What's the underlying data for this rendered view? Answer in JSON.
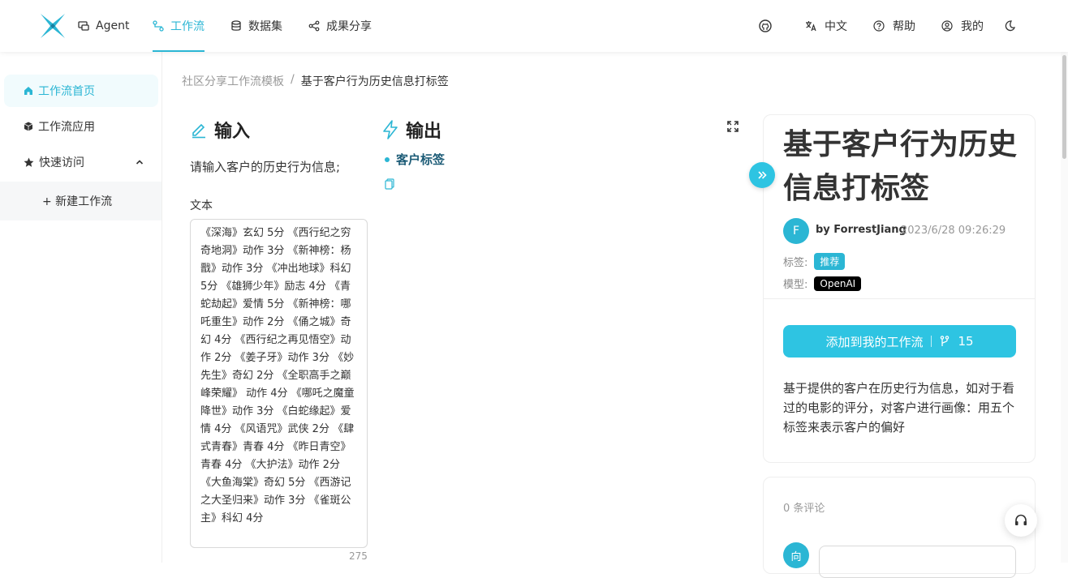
{
  "nav": {
    "items": [
      {
        "label": "Agent",
        "icon": "chat-icon"
      },
      {
        "label": "工作流",
        "icon": "workflow-icon",
        "active": true
      },
      {
        "label": "数据集",
        "icon": "database-icon"
      },
      {
        "label": "成果分享",
        "icon": "share-icon"
      }
    ],
    "lang": "中文",
    "help": "帮助",
    "mine": "我的"
  },
  "sidebar": {
    "items": [
      {
        "label": "工作流首页",
        "icon": "home-icon",
        "active": true
      },
      {
        "label": "工作流应用",
        "icon": "cube-icon"
      },
      {
        "label": "快速访问",
        "icon": "star-icon"
      }
    ],
    "sub_item": "+ 新建工作流"
  },
  "breadcrumb": {
    "parent": "社区分享工作流模板",
    "sep": "/",
    "current": "基于客户行为历史信息打标签"
  },
  "input": {
    "title": "输入",
    "prompt": "请输入客户的历史行为信息;",
    "field_label": "文本",
    "text": "《深海》玄幻  5分 《西行纪之穷奇地洞》动作 3分 《新神榜：杨戬》动作 3分 《冲出地球》科幻 5分  《雄狮少年》励志 4分 《青蛇劫起》爱情 5分 《新神榜：哪吒重生》动作 2分 《俑之城》奇幻 4分 《西行纪之再见悟空》动作 2分 《姜子牙》动作 3分 《妙先生》奇幻 2分 《全职高手之巅峰荣耀》 动作 4分 《哪吒之魔童降世》动作 3分 《白蛇缘起》爱情 4分 《风语咒》武侠 2分 《肆式青春》青春 4分 《昨日青空》青春 4分 《大护法》动作 2分 《大鱼海棠》奇幻 5分 《西游记之大圣归来》动作 3分 《雀斑公主》科幻 4分",
    "count": "275"
  },
  "output": {
    "title": "输出",
    "tag": "客户标签"
  },
  "card": {
    "title": "基于客户行为历史信息打标签",
    "avatar_letter": "F",
    "author": "by ForrestJiang",
    "date": "2023/6/28 09:26:29",
    "tags_label": "标签:",
    "tag": "推荐",
    "model_label": "模型:",
    "model": "OpenAI",
    "add_button": "添加到我的工作流",
    "fork_count": "15",
    "description": "基于提供的客户在历史行为信息，如对于看过的电影的评分，对客户进行画像：用五个标签来表示客户的偏好"
  },
  "comments": {
    "count": "0 条评论",
    "avatar_letter": "向"
  },
  "colors": {
    "accent": "#2bb6d4",
    "button": "#2ec4e2",
    "model_badge": "#000000"
  }
}
